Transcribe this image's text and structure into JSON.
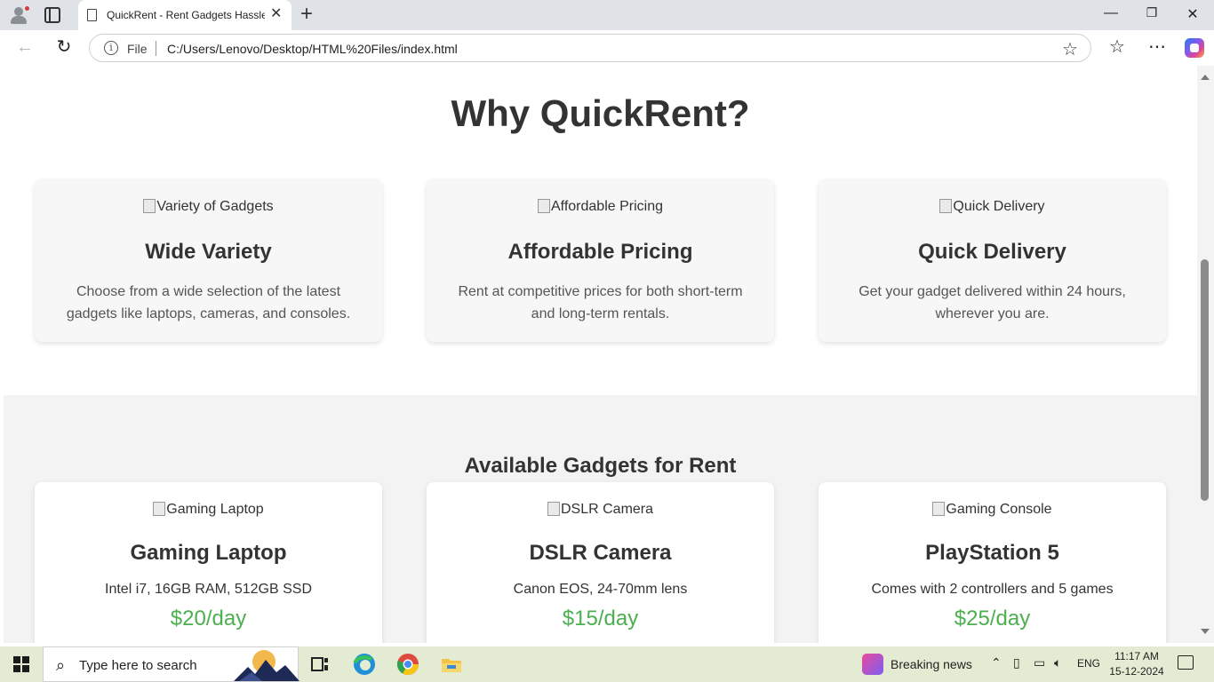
{
  "browser": {
    "tab_title": "QuickRent - Rent Gadgets Hassle-Free",
    "url_scheme_label": "File",
    "url": "C:/Users/Lenovo/Desktop/HTML%20Files/index.html"
  },
  "why": {
    "title": "Why QuickRent?",
    "features": [
      {
        "img_alt": "Variety of Gadgets",
        "title": "Wide Variety",
        "text": "Choose from a wide selection of the latest gadgets like laptops, cameras, and consoles."
      },
      {
        "img_alt": "Affordable Pricing",
        "title": "Affordable Pricing",
        "text": "Rent at competitive prices for both short-term and long-term rentals."
      },
      {
        "img_alt": "Quick Delivery",
        "title": "Quick Delivery",
        "text": "Get your gadget delivered within 24 hours, wherever you are."
      }
    ]
  },
  "gadgets": {
    "title": "Available Gadgets for Rent",
    "items": [
      {
        "img_alt": "Gaming Laptop",
        "name": "Gaming Laptop",
        "spec": "Intel i7, 16GB RAM, 512GB SSD",
        "price": "$20/day"
      },
      {
        "img_alt": "DSLR Camera",
        "name": "DSLR Camera",
        "spec": "Canon EOS, 24-70mm lens",
        "price": "$15/day"
      },
      {
        "img_alt": "Gaming Console",
        "name": "PlayStation 5",
        "spec": "Comes with 2 controllers and 5 games",
        "price": "$25/day"
      }
    ]
  },
  "taskbar": {
    "search_placeholder": "Type here to search",
    "news_label": "Breaking news",
    "language": "ENG",
    "time": "11:17 AM",
    "date": "15-12-2024"
  },
  "colors": {
    "price_green": "#4caf50",
    "taskbar_bg": "#e3ecd2",
    "section_alt_bg": "#f3f3f3"
  }
}
